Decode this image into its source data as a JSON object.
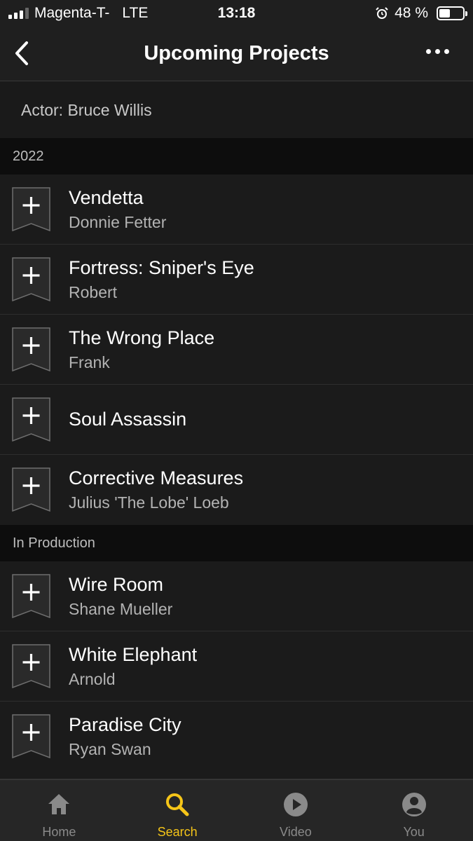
{
  "status_bar": {
    "carrier": "Magenta-T-",
    "network": "LTE",
    "time": "13:18",
    "battery_text": "48 %",
    "battery_level": 0.48
  },
  "nav": {
    "title": "Upcoming Projects"
  },
  "actor_line": "Actor: Bruce Willis",
  "sections": [
    {
      "header": "2022",
      "items": [
        {
          "title": "Vendetta",
          "role": "Donnie Fetter"
        },
        {
          "title": "Fortress: Sniper's Eye",
          "role": "Robert"
        },
        {
          "title": "The Wrong Place",
          "role": "Frank"
        },
        {
          "title": "Soul Assassin",
          "role": ""
        },
        {
          "title": "Corrective Measures",
          "role": "Julius 'The Lobe' Loeb"
        }
      ]
    },
    {
      "header": "In Production",
      "items": [
        {
          "title": "Wire Room",
          "role": "Shane Mueller"
        },
        {
          "title": "White Elephant",
          "role": "Arnold"
        },
        {
          "title": "Paradise City",
          "role": "Ryan Swan"
        }
      ]
    }
  ],
  "tabs": [
    {
      "label": "Home",
      "icon": "home-icon"
    },
    {
      "label": "Search",
      "icon": "search-icon",
      "active": true
    },
    {
      "label": "Video",
      "icon": "play-icon"
    },
    {
      "label": "You",
      "icon": "user-icon"
    }
  ],
  "colors": {
    "accent": "#f5c518",
    "background": "#1a1a1a",
    "section_header_bg": "#0d0d0d"
  }
}
